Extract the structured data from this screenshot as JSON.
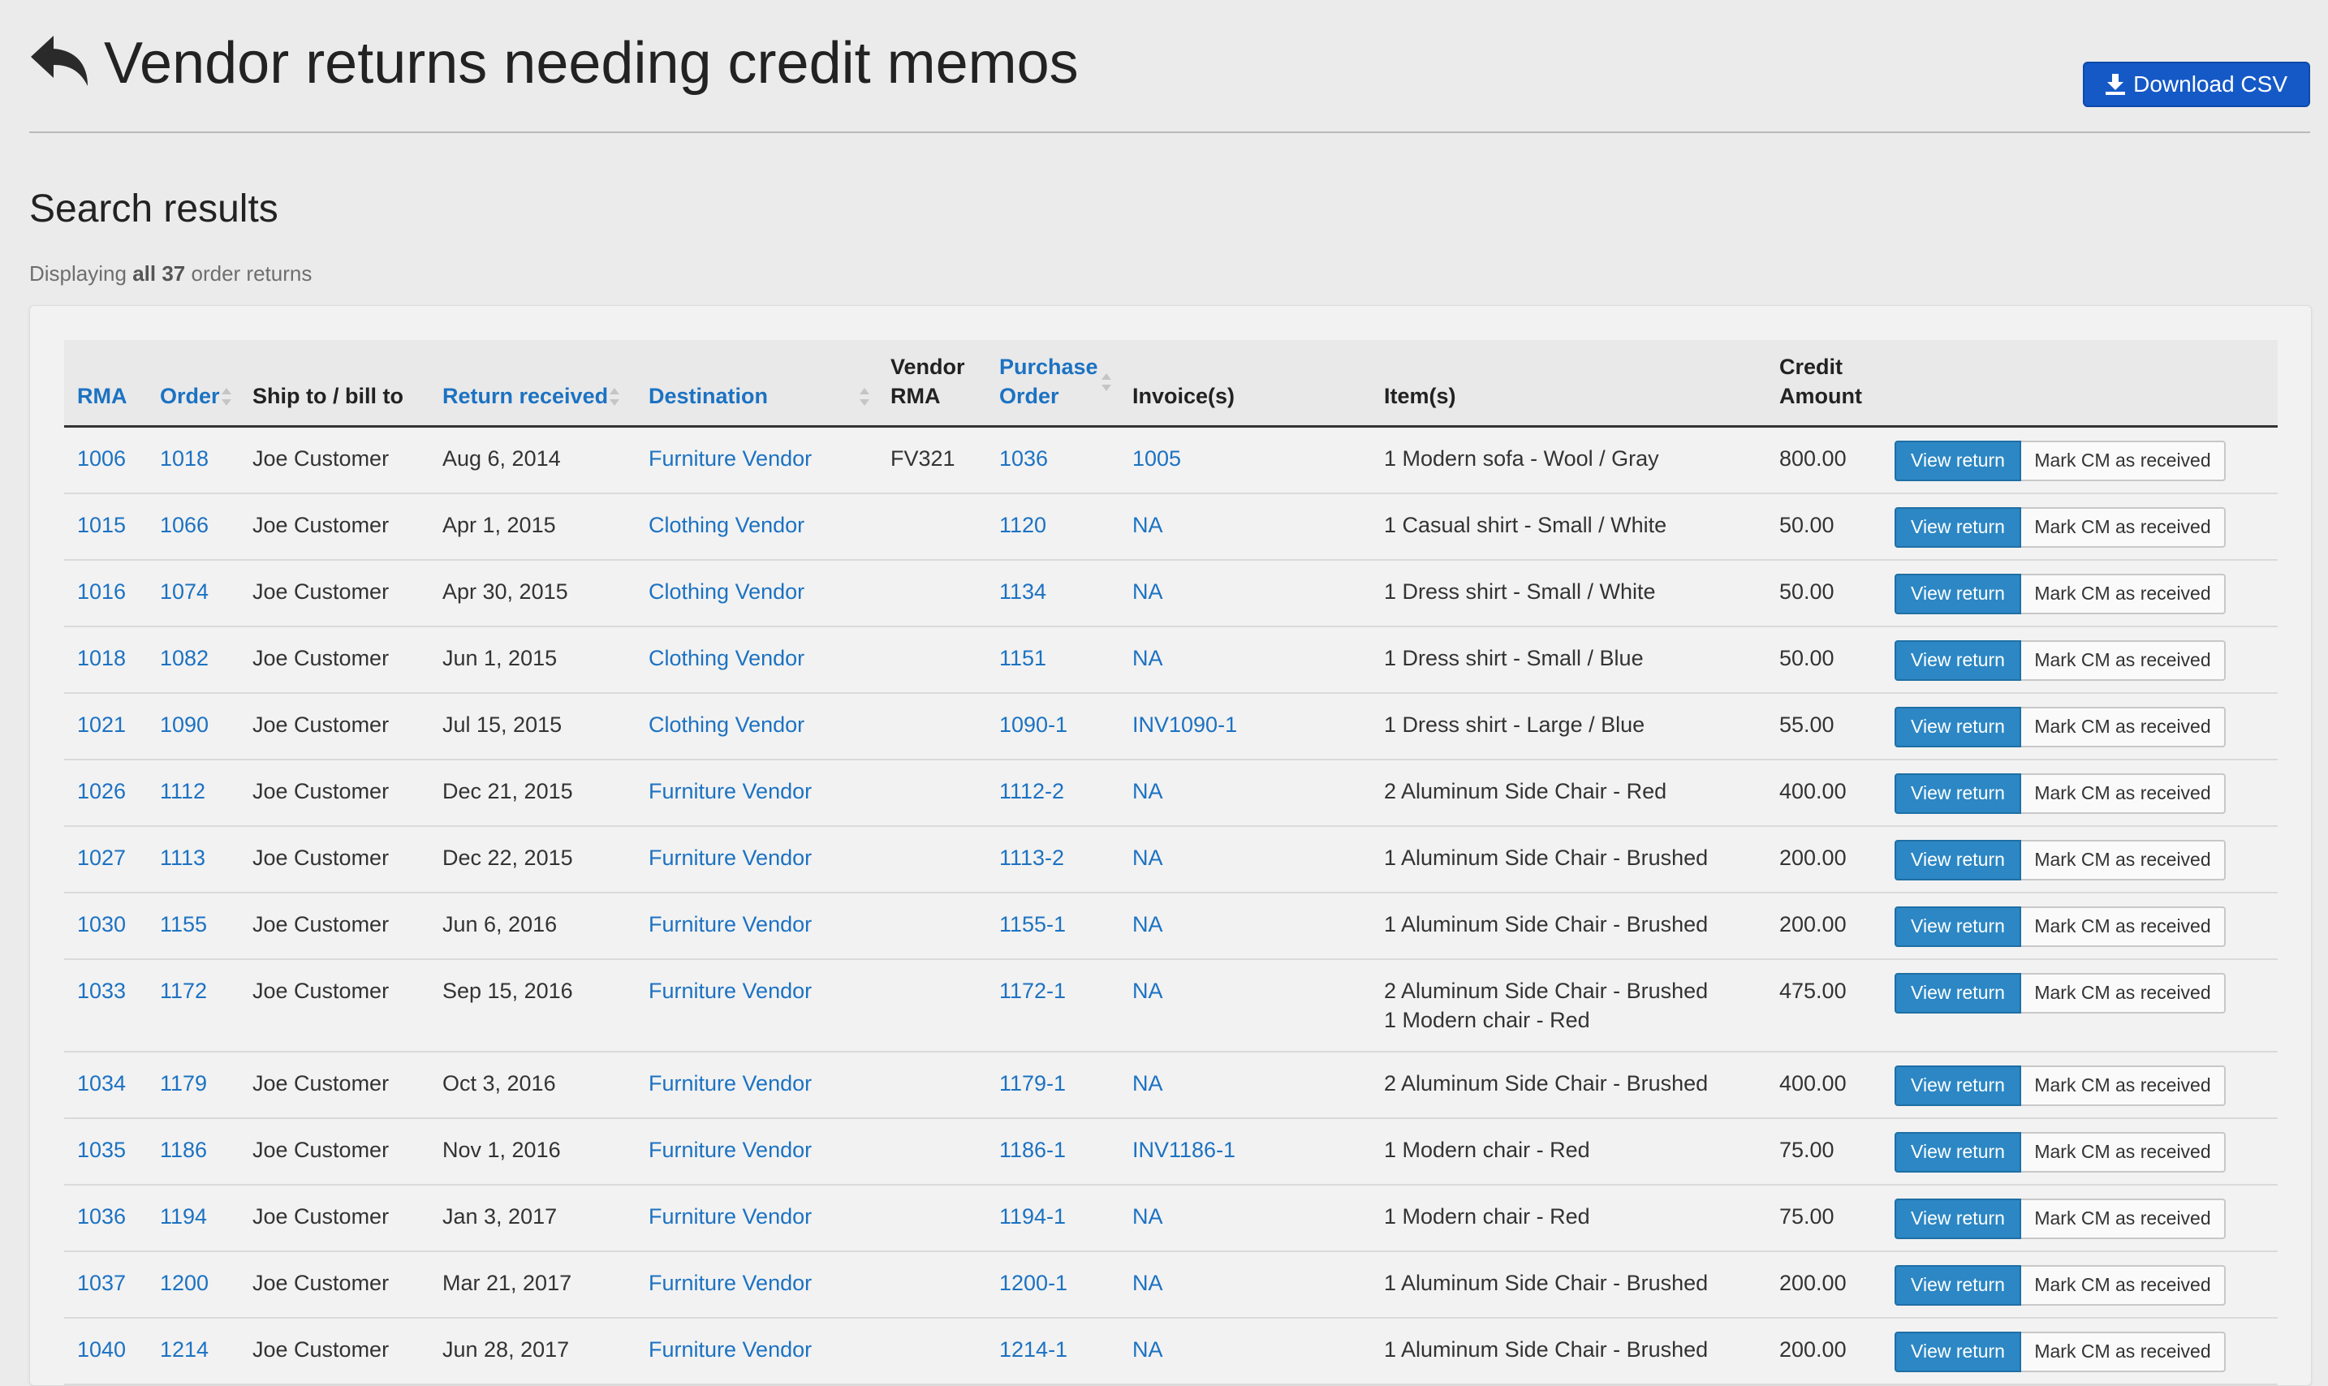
{
  "header": {
    "title": "Vendor returns needing credit memos",
    "download_label": "Download CSV"
  },
  "results": {
    "heading": "Search results",
    "summary_prefix": "Displaying",
    "summary_all": "all 37",
    "summary_suffix": "order returns"
  },
  "table": {
    "headers": {
      "rma": "RMA",
      "order": "Order",
      "ship_to": "Ship to / bill to",
      "return_received": "Return received",
      "destination": "Destination",
      "vendor_rma_1": "Vendor",
      "vendor_rma_2": "RMA",
      "purchase_order_1": "Purchase",
      "purchase_order_2": "Order",
      "invoices": "Invoice(s)",
      "items": "Item(s)",
      "credit_amount_1": "Credit",
      "credit_amount_2": "Amount"
    },
    "view_return_label": "View return",
    "mark_cm_label": "Mark CM as received",
    "rows": [
      {
        "rma": "1006",
        "order": "1018",
        "ship_to": "Joe Customer",
        "received": "Aug 6, 2014",
        "destination": "Furniture Vendor",
        "vendor_rma": "FV321",
        "po": "1036",
        "invoice": "1005",
        "items": [
          "1 Modern sofa - Wool / Gray"
        ],
        "amount": "800.00"
      },
      {
        "rma": "1015",
        "order": "1066",
        "ship_to": "Joe Customer",
        "received": "Apr 1, 2015",
        "destination": "Clothing Vendor",
        "vendor_rma": "",
        "po": "1120",
        "invoice": "NA",
        "items": [
          "1 Casual shirt - Small / White"
        ],
        "amount": "50.00"
      },
      {
        "rma": "1016",
        "order": "1074",
        "ship_to": "Joe Customer",
        "received": "Apr 30, 2015",
        "destination": "Clothing Vendor",
        "vendor_rma": "",
        "po": "1134",
        "invoice": "NA",
        "items": [
          "1 Dress shirt - Small / White"
        ],
        "amount": "50.00"
      },
      {
        "rma": "1018",
        "order": "1082",
        "ship_to": "Joe Customer",
        "received": "Jun 1, 2015",
        "destination": "Clothing Vendor",
        "vendor_rma": "",
        "po": "1151",
        "invoice": "NA",
        "items": [
          "1 Dress shirt - Small / Blue"
        ],
        "amount": "50.00"
      },
      {
        "rma": "1021",
        "order": "1090",
        "ship_to": "Joe Customer",
        "received": "Jul 15, 2015",
        "destination": "Clothing Vendor",
        "vendor_rma": "",
        "po": "1090-1",
        "invoice": "INV1090-1",
        "items": [
          "1 Dress shirt - Large / Blue"
        ],
        "amount": "55.00"
      },
      {
        "rma": "1026",
        "order": "1112",
        "ship_to": "Joe Customer",
        "received": "Dec 21, 2015",
        "destination": "Furniture Vendor",
        "vendor_rma": "",
        "po": "1112-2",
        "invoice": "NA",
        "items": [
          "2 Aluminum Side Chair - Red"
        ],
        "amount": "400.00"
      },
      {
        "rma": "1027",
        "order": "1113",
        "ship_to": "Joe Customer",
        "received": "Dec 22, 2015",
        "destination": "Furniture Vendor",
        "vendor_rma": "",
        "po": "1113-2",
        "invoice": "NA",
        "items": [
          "1 Aluminum Side Chair - Brushed"
        ],
        "amount": "200.00"
      },
      {
        "rma": "1030",
        "order": "1155",
        "ship_to": "Joe Customer",
        "received": "Jun 6, 2016",
        "destination": "Furniture Vendor",
        "vendor_rma": "",
        "po": "1155-1",
        "invoice": "NA",
        "items": [
          "1 Aluminum Side Chair - Brushed"
        ],
        "amount": "200.00"
      },
      {
        "rma": "1033",
        "order": "1172",
        "ship_to": "Joe Customer",
        "received": "Sep 15, 2016",
        "destination": "Furniture Vendor",
        "vendor_rma": "",
        "po": "1172-1",
        "invoice": "NA",
        "items": [
          "2 Aluminum Side Chair - Brushed",
          "1 Modern chair - Red"
        ],
        "amount": "475.00"
      },
      {
        "rma": "1034",
        "order": "1179",
        "ship_to": "Joe Customer",
        "received": "Oct 3, 2016",
        "destination": "Furniture Vendor",
        "vendor_rma": "",
        "po": "1179-1",
        "invoice": "NA",
        "items": [
          "2 Aluminum Side Chair - Brushed"
        ],
        "amount": "400.00"
      },
      {
        "rma": "1035",
        "order": "1186",
        "ship_to": "Joe Customer",
        "received": "Nov 1, 2016",
        "destination": "Furniture Vendor",
        "vendor_rma": "",
        "po": "1186-1",
        "invoice": "INV1186-1",
        "items": [
          "1 Modern chair - Red"
        ],
        "amount": "75.00"
      },
      {
        "rma": "1036",
        "order": "1194",
        "ship_to": "Joe Customer",
        "received": "Jan 3, 2017",
        "destination": "Furniture Vendor",
        "vendor_rma": "",
        "po": "1194-1",
        "invoice": "NA",
        "items": [
          "1 Modern chair - Red"
        ],
        "amount": "75.00"
      },
      {
        "rma": "1037",
        "order": "1200",
        "ship_to": "Joe Customer",
        "received": "Mar 21, 2017",
        "destination": "Furniture Vendor",
        "vendor_rma": "",
        "po": "1200-1",
        "invoice": "NA",
        "items": [
          "1 Aluminum Side Chair - Brushed"
        ],
        "amount": "200.00"
      },
      {
        "rma": "1040",
        "order": "1214",
        "ship_to": "Joe Customer",
        "received": "Jun 28, 2017",
        "destination": "Furniture Vendor",
        "vendor_rma": "",
        "po": "1214-1",
        "invoice": "NA",
        "items": [
          "1 Aluminum Side Chair - Brushed"
        ],
        "amount": "200.00"
      }
    ]
  },
  "colors": {
    "link": "#1c72c2",
    "download_button": "#1559c7",
    "view_button": "#2c87c4",
    "background": "#ebebeb"
  },
  "icons": {
    "title_icon": "reply-arrow-icon",
    "download_icon": "download-icon",
    "sort_icon": "sort-icon"
  }
}
